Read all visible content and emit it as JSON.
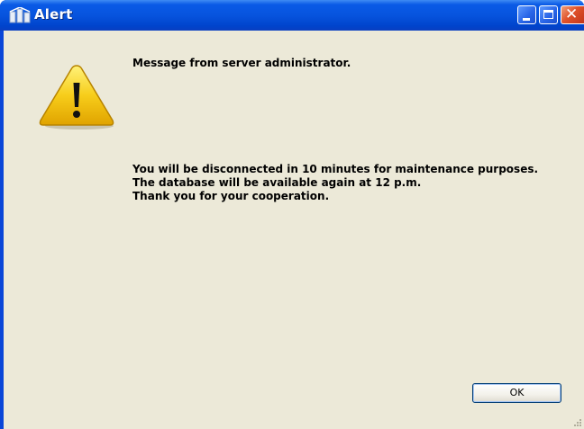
{
  "window": {
    "title": "Alert",
    "title_icon": "app-icon",
    "controls": {
      "minimize": "minimize-button",
      "maximize": "maximize-button",
      "close": "close-button"
    }
  },
  "dialog": {
    "icon": "warning-icon",
    "heading": "Message from server administrator.",
    "lines": [
      "You will be disconnected in 10 minutes for maintenance purposes.",
      "The database will be available again at 12 p.m.",
      "Thank you for your cooperation."
    ],
    "ok_label": "OK"
  },
  "colors": {
    "titlebar": "#0754de",
    "client_background": "#ece9d8",
    "close_button": "#e0522a",
    "warning_yellow": "#f5c400"
  }
}
